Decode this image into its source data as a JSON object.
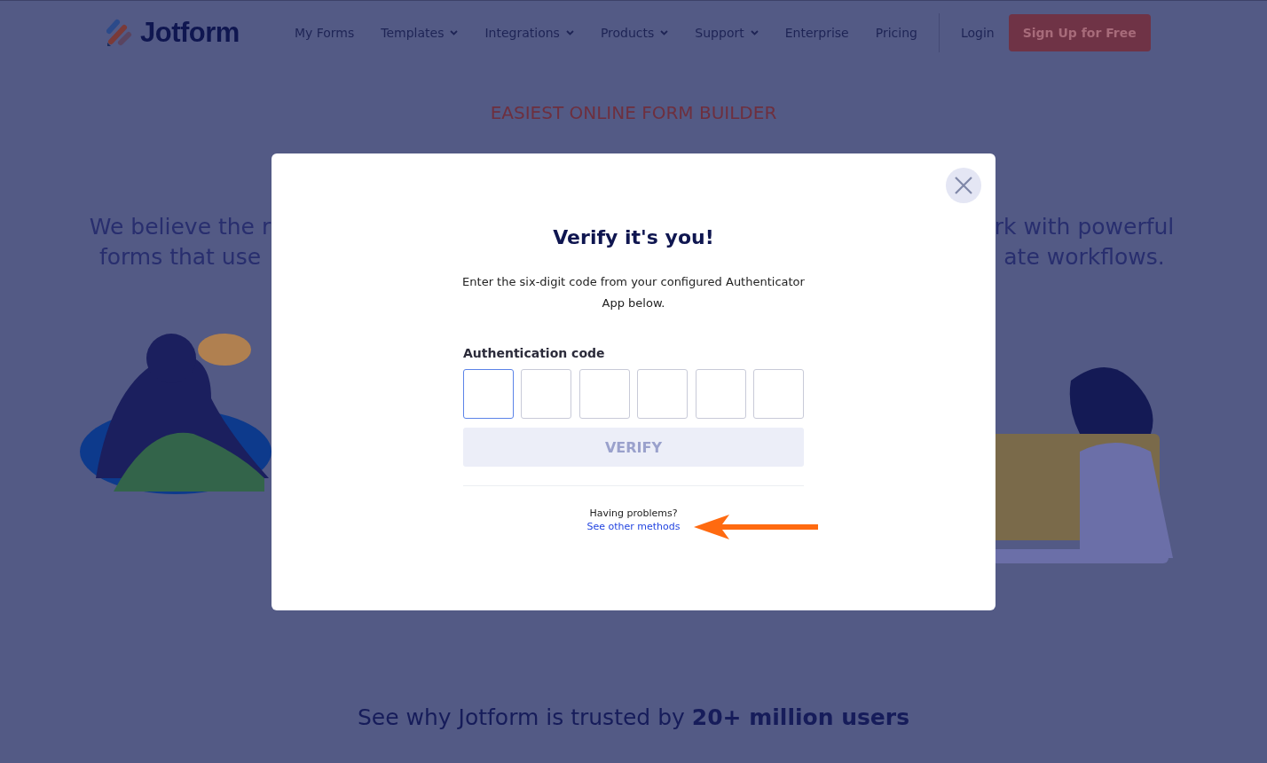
{
  "nav": {
    "brand": "Jotform",
    "links": [
      {
        "label": "My Forms",
        "dropdown": false
      },
      {
        "label": "Templates",
        "dropdown": true
      },
      {
        "label": "Integrations",
        "dropdown": true
      },
      {
        "label": "Products",
        "dropdown": true
      },
      {
        "label": "Support",
        "dropdown": true
      },
      {
        "label": "Enterprise",
        "dropdown": false
      },
      {
        "label": "Pricing",
        "dropdown": false
      }
    ],
    "login": "Login",
    "signup": "Sign Up for Free"
  },
  "hero": {
    "eyebrow": "EASIEST ONLINE FORM BUILDER",
    "left_lines": [
      "We believe the r",
      "forms that use"
    ],
    "right_lines": [
      "rk with powerful",
      "ate workflows."
    ]
  },
  "trust": "See why Jotform is trusted by **20+ million users**",
  "dialog": {
    "title": "Verify it's you!",
    "description": "Enter the six-digit code from your configured Authenticator App below.",
    "code_label": "Authentication code",
    "code_boxes": [
      {
        "focused": true
      },
      {
        "focused": false
      },
      {
        "focused": false
      },
      {
        "focused": false
      },
      {
        "focused": false
      },
      {
        "focused": false
      }
    ],
    "verify": {
      "label": "VERIFY",
      "disabled": true
    },
    "help": "Having problems?",
    "help_link": "See other methods"
  }
}
